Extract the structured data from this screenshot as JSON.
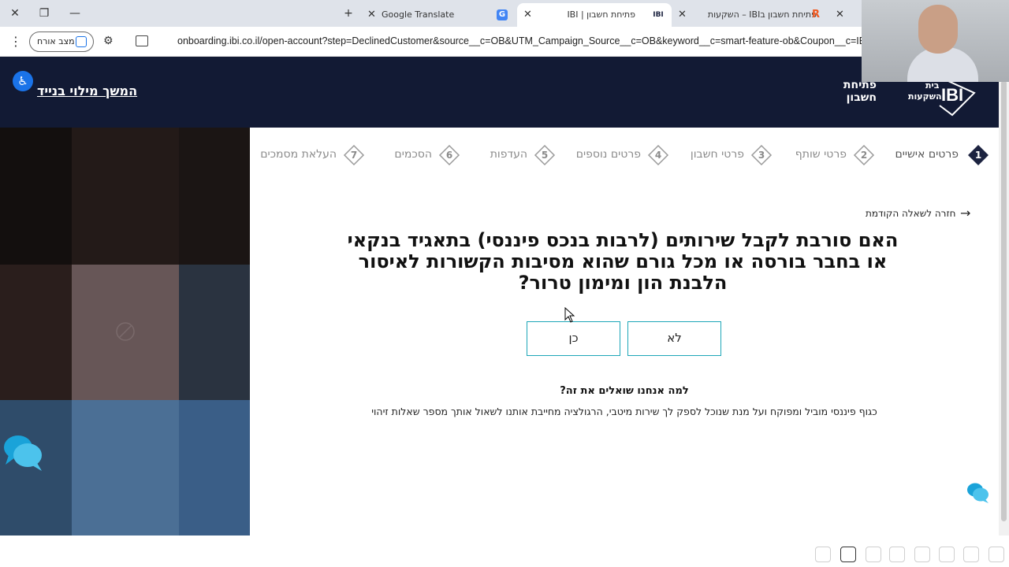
{
  "browser": {
    "tabs": [
      {
        "title": "Google Translate",
        "favicon": "google-translate-icon"
      },
      {
        "title": "פתיחת חשבון | IBI",
        "favicon": "ibi-icon",
        "active": true
      },
      {
        "title": "פתיחת חשבון בIBI – השקעות",
        "favicon": "r-icon"
      }
    ],
    "new_tab_label": "+",
    "guest_label": "מצב אורח",
    "url": "onboarding.ibi.co.il/open-account?step=DeclinedCustomer&source__c=OB&UTM_Campaign_Source__c=OB&keyword__c=smart-feature-ob&Coupon__c=IBIRHONZ&ref"
  },
  "header": {
    "continue_link": "המשך מילוי בנייד",
    "open_account": "פתיחת חשבון",
    "logo_text_top": "בית",
    "logo_text_bottom": "השקעות",
    "logo_mark": "IBI"
  },
  "steps": [
    {
      "number": "1",
      "label": "פרטים אישיים",
      "active": true
    },
    {
      "number": "2",
      "label": "פרטי שותף"
    },
    {
      "number": "3",
      "label": "פרטי חשבון"
    },
    {
      "number": "4",
      "label": "פרטים נוספים"
    },
    {
      "number": "5",
      "label": "העדפות"
    },
    {
      "number": "6",
      "label": "הסכמים"
    },
    {
      "number": "7",
      "label": "העלאת מסמכים"
    }
  ],
  "question": {
    "back_link": "חזרה לשאלה הקודמת",
    "text": "האם סורבת לקבל שירותים (לרבות בנכס פיננסי) בתאגיד בנקאי או בחבר בורסה או מכל גורם שהוא מסיבות הקשורות לאיסור הלבנת הון ומימון טרור?",
    "answer_no": "לא",
    "answer_yes": "כן"
  },
  "why": {
    "title": "למה אנחנו שואלים את זה?",
    "body": "כגוף פיננסי מוביל ומפוקח ועל מנת שנוכל לספק לך שירות מיטבי, הרגולציה מחייבת אותנו לשאול אותך מספר שאלות זיהוי"
  },
  "colors": {
    "header_bg": "#121a34",
    "accent_teal": "#1ea7b8",
    "chat_blue": "#1aa3d9",
    "step_active": "#1c2340"
  }
}
